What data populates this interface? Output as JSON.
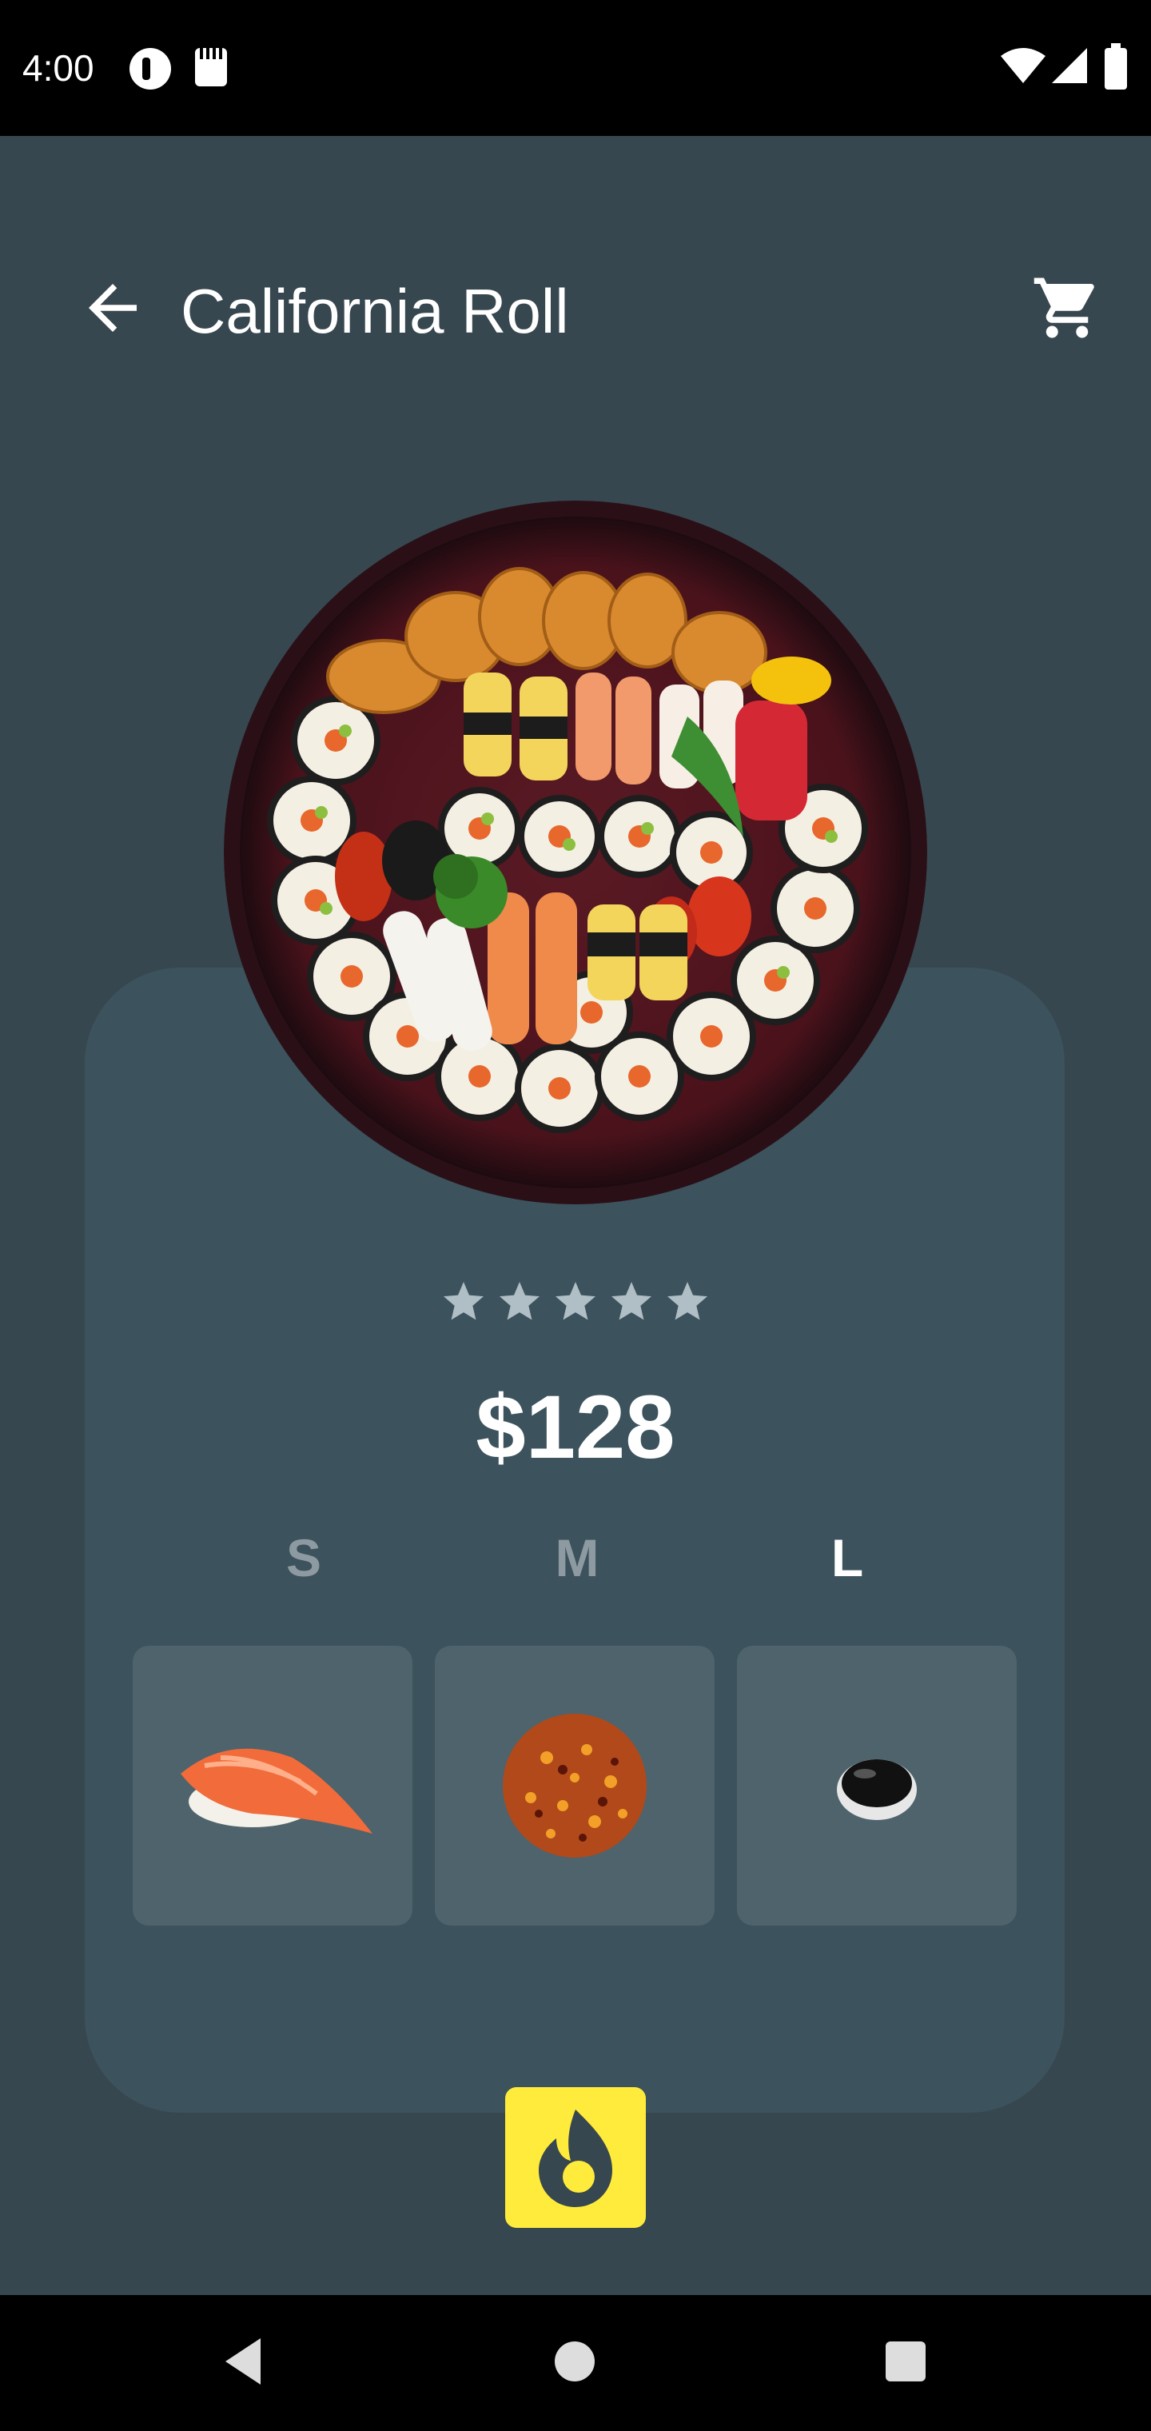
{
  "status_bar": {
    "time": "4:00"
  },
  "header": {
    "title": "California Roll"
  },
  "product": {
    "rating": 5,
    "rating_max": 5,
    "price": "$128"
  },
  "sizes": {
    "items": [
      "S",
      "M",
      "L"
    ],
    "selected": "L"
  },
  "toppings": [
    {
      "name": "salmon-nigiri-icon"
    },
    {
      "name": "chili-flakes-icon"
    },
    {
      "name": "soy-sauce-icon"
    }
  ],
  "colors": {
    "background": "#37474f",
    "card": "#3c525c",
    "tile": "#4e636c",
    "accent": "#ffeb3b"
  }
}
